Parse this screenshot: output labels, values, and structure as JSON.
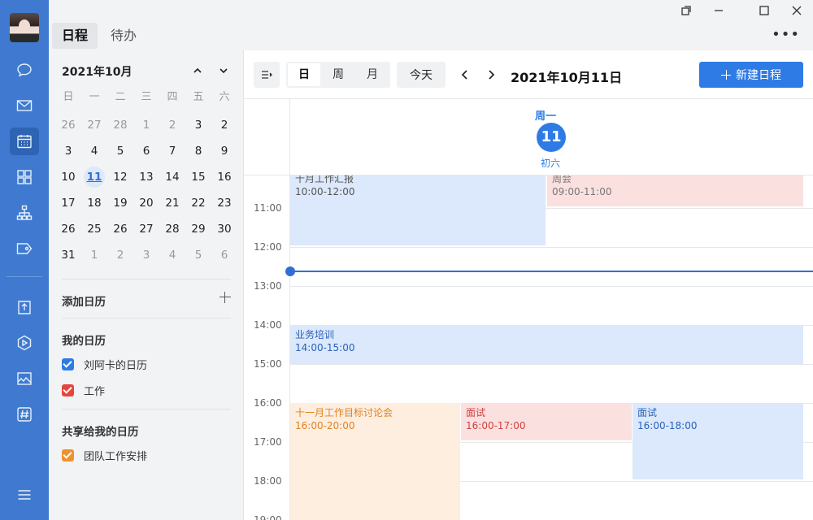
{
  "tabs": [
    {
      "label": "日程",
      "active": true
    },
    {
      "label": "待办",
      "active": false
    }
  ],
  "mini_calendar": {
    "title": "2021年10月",
    "weekdays": [
      "日",
      "一",
      "二",
      "三",
      "四",
      "五",
      "六"
    ],
    "weeks": [
      [
        "26",
        "27",
        "28",
        "1",
        "2",
        "3",
        "2"
      ],
      [
        "3",
        "4",
        "5",
        "6",
        "7",
        "8",
        "9"
      ],
      [
        "10",
        "11",
        "12",
        "13",
        "14",
        "15",
        "16"
      ],
      [
        "17",
        "18",
        "19",
        "20",
        "21",
        "22",
        "23"
      ],
      [
        "26",
        "25",
        "26",
        "27",
        "28",
        "29",
        "30"
      ],
      [
        "31",
        "1",
        "2",
        "3",
        "4",
        "5",
        "6"
      ]
    ],
    "other_month": [
      [
        0,
        0
      ],
      [
        0,
        1
      ],
      [
        0,
        2
      ],
      [
        0,
        3
      ],
      [
        0,
        4
      ],
      [
        5,
        1
      ],
      [
        5,
        2
      ],
      [
        5,
        3
      ],
      [
        5,
        4
      ],
      [
        5,
        5
      ],
      [
        5,
        6
      ]
    ],
    "today": [
      2,
      1
    ]
  },
  "sidebar": {
    "add_calendar_label": "添加日历",
    "my_calendars_title": "我的日历",
    "my_calendars": [
      {
        "label": "刘阿卡的日历",
        "color": "#2f7be5"
      },
      {
        "label": "工作",
        "color": "#e4463f"
      }
    ],
    "shared_title": "共享给我的日历",
    "shared_calendars": [
      {
        "label": "团队工作安排",
        "color": "#f0922c"
      }
    ]
  },
  "toolbar": {
    "view_options": [
      "日",
      "周",
      "月"
    ],
    "active_view": "日",
    "today_label": "今天",
    "current_date": "2021年10月11日",
    "new_event_label": "新建日程"
  },
  "day_header": {
    "weekday": "周一",
    "day": "11",
    "lunar": "初六"
  },
  "time_labels": [
    "11:00",
    "12:00",
    "13:00",
    "14:00",
    "15:00",
    "16:00",
    "17:00",
    "18:00",
    "19:00"
  ],
  "events": [
    {
      "title": "十月工作汇报",
      "time": "10:00-12:00",
      "color": "blue"
    },
    {
      "title": "周会",
      "time": "09:00-11:00",
      "color": "red"
    },
    {
      "title": "业务培训",
      "time": "14:00-15:00",
      "color": "blue"
    },
    {
      "title": "十一月工作目标讨论会",
      "time": "16:00-20:00",
      "color": "orange"
    },
    {
      "title": "面试",
      "time": "16:00-17:00",
      "color": "red"
    },
    {
      "title": "面试",
      "time": "16:00-18:00",
      "color": "blue"
    }
  ],
  "colors": {
    "rail": "#3f7ad0",
    "accent": "#2f7be5",
    "event_blue": "#dce8fb",
    "event_red": "#fbe0e0",
    "event_orange": "#fdeee0"
  }
}
